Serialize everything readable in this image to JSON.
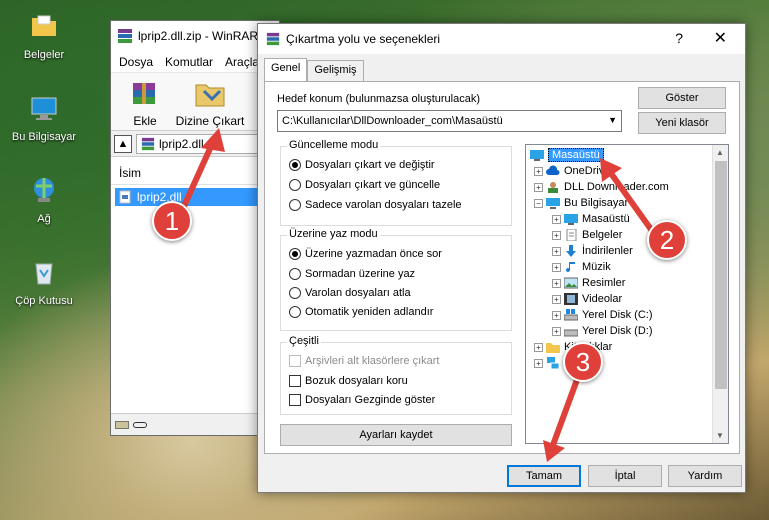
{
  "desktop": {
    "icons": [
      {
        "label": "Belgeler"
      },
      {
        "label": "Bu Bilgisayar"
      },
      {
        "label": "Ağ"
      },
      {
        "label": "Çöp Kutusu"
      }
    ]
  },
  "winrar": {
    "title": "lprip2.dll.zip - WinRAR",
    "menu": [
      "Dosya",
      "Komutlar",
      "Araçlar"
    ],
    "toolbar": {
      "add": "Ekle",
      "extract": "Dizine Çıkart"
    },
    "path": "lprip2.dll.zip",
    "list_header": "İsim",
    "file": "lprip2.dll"
  },
  "dialog": {
    "title": "Çıkartma yolu ve seçenekleri",
    "help": "?",
    "close": "✕",
    "tabs": [
      "Genel",
      "Gelişmiş"
    ],
    "dest_label": "Hedef konum (bulunmazsa oluşturulacak)",
    "dest_value": "C:\\Kullanıcılar\\DllDownloader_com\\Masaüstü",
    "btn_show": "Göster",
    "btn_newfolder": "Yeni klasör",
    "update_mode": {
      "title": "Güncelleme modu",
      "options": [
        "Dosyaları çıkart ve değiştir",
        "Dosyaları çıkart ve güncelle",
        "Sadece varolan dosyaları tazele"
      ],
      "selected": 0
    },
    "overwrite_mode": {
      "title": "Üzerine yaz modu",
      "options": [
        "Üzerine yazmadan önce sor",
        "Sormadan üzerine yaz",
        "Varolan dosyaları atla",
        "Otomatik yeniden adlandır"
      ],
      "selected": 0
    },
    "misc": {
      "title": "Çeşitli",
      "options": [
        "Arşivleri alt klasörlere çıkart",
        "Bozuk dosyaları koru",
        "Dosyaları Gezginde göster"
      ]
    },
    "btn_save": "Ayarları kaydet",
    "tree": [
      {
        "label": "Masaüstü",
        "selected": true
      },
      {
        "label": "OneDrive"
      },
      {
        "label": "DLL Downloader.com"
      },
      {
        "label": "Bu Bilgisayar"
      },
      {
        "label": "Masaüstü"
      },
      {
        "label": "Belgeler"
      },
      {
        "label": "İndirilenler"
      },
      {
        "label": "Müzik"
      },
      {
        "label": "Resimler"
      },
      {
        "label": "Videolar"
      },
      {
        "label": "Yerel Disk (C:)"
      },
      {
        "label": "Yerel Disk (D:)"
      },
      {
        "label": "Kitaplıklar"
      },
      {
        "label": "Ağ"
      }
    ],
    "btn_ok": "Tamam",
    "btn_cancel": "İptal",
    "btn_help": "Yardım"
  },
  "annotations": {
    "step1": "1",
    "step2": "2",
    "step3": "3",
    "color": "#e0403a"
  }
}
